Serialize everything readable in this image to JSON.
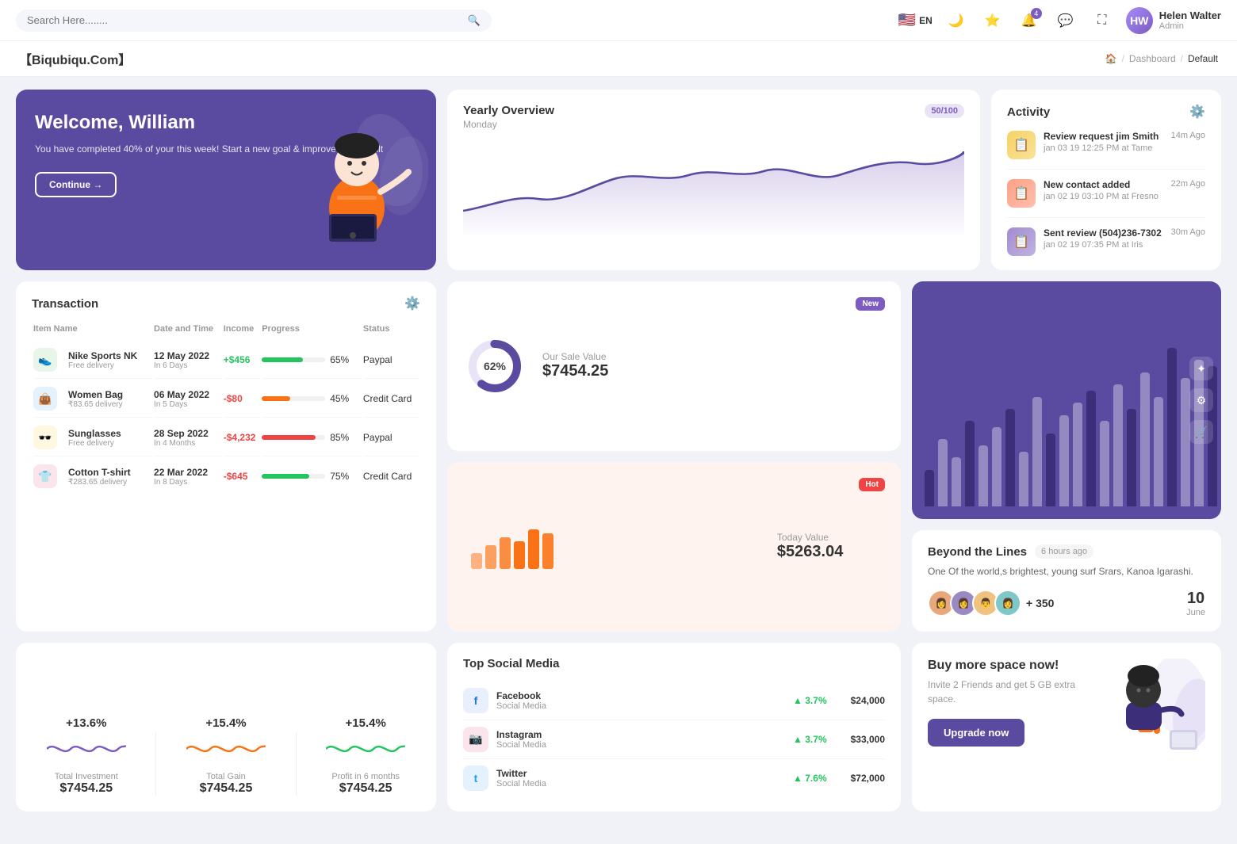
{
  "nav": {
    "search_placeholder": "Search Here........",
    "lang": "EN",
    "user": {
      "name": "Helen Walter",
      "role": "Admin",
      "initials": "HW"
    },
    "bell_count": "4"
  },
  "breadcrumb": {
    "brand": "【Biqubiqu.Com】",
    "home": "🏠",
    "dashboard": "Dashboard",
    "current": "Default"
  },
  "welcome": {
    "title": "Welcome, William",
    "body": "You have completed 40% of your this week! Start a new goal & improve your result",
    "button": "Continue →"
  },
  "overview": {
    "title": "Yearly Overview",
    "day": "Monday",
    "progress": "50/100"
  },
  "activity": {
    "title": "Activity",
    "items": [
      {
        "title": "Review request jim Smith",
        "sub": "jan 03 19 12:25 PM at Tame",
        "time": "14m Ago",
        "color": "#f6d365"
      },
      {
        "title": "New contact added",
        "sub": "jan 02 19 03:10 PM at Fresno",
        "time": "22m Ago",
        "color": "#fda085"
      },
      {
        "title": "Sent review (504)236-7302",
        "sub": "jan 02 19 07:35 PM at Iris",
        "time": "30m Ago",
        "color": "#a18cd1"
      }
    ]
  },
  "transaction": {
    "title": "Transaction",
    "columns": [
      "Item Name",
      "Date and Time",
      "Income",
      "Progress",
      "Status"
    ],
    "rows": [
      {
        "icon": "👟",
        "icon_bg": "#e8f5e9",
        "name": "Nike Sports NK",
        "sub": "Free delivery",
        "date": "12 May 2022",
        "days": "In 6 Days",
        "income": "+$456",
        "income_type": "pos",
        "progress": 65,
        "progress_color": "#22c55e",
        "status": "Paypal"
      },
      {
        "icon": "👜",
        "icon_bg": "#e3f2fd",
        "name": "Women Bag",
        "sub": "₹83.65 delivery",
        "date": "06 May 2022",
        "days": "In 5 Days",
        "income": "-$80",
        "income_type": "neg",
        "progress": 45,
        "progress_color": "#f97316",
        "status": "Credit Card"
      },
      {
        "icon": "🕶️",
        "icon_bg": "#fff8e1",
        "name": "Sunglasses",
        "sub": "Free delivery",
        "date": "28 Sep 2022",
        "days": "In 4 Months",
        "income": "-$4,232",
        "income_type": "neg",
        "progress": 85,
        "progress_color": "#ef4444",
        "status": "Paypal"
      },
      {
        "icon": "👕",
        "icon_bg": "#fce4ec",
        "name": "Cotton T-shirt",
        "sub": "₹283.65 delivery",
        "date": "22 Mar 2022",
        "days": "In 8 Days",
        "income": "-$645",
        "income_type": "neg",
        "progress": 75,
        "progress_color": "#22c55e",
        "status": "Credit Card"
      }
    ]
  },
  "sale_value": {
    "label": "Our Sale Value",
    "amount": "$7454.25",
    "pct": "62%",
    "badge": "New"
  },
  "today_value": {
    "label": "Today Value",
    "amount": "$5263.04",
    "badge": "Hot"
  },
  "beyond": {
    "title": "Beyond the Lines",
    "time_ago": "6 hours ago",
    "description": "One Of the world,s brightest, young surf Srars, Kanoa Igarashi.",
    "plus_count": "+ 350",
    "date_num": "10",
    "date_month": "June",
    "avatars": [
      "👩",
      "👩",
      "👨",
      "👩"
    ]
  },
  "stats": [
    {
      "pct": "+13.6%",
      "label": "Total Investment",
      "value": "$7454.25",
      "color": "#7c5cbf"
    },
    {
      "pct": "+15.4%",
      "label": "Total Gain",
      "value": "$7454.25",
      "color": "#f97316"
    },
    {
      "pct": "+15.4%",
      "label": "Profit in 6 months",
      "value": "$7454.25",
      "color": "#22c55e"
    }
  ],
  "social": {
    "title": "Top Social Media",
    "items": [
      {
        "name": "Facebook",
        "sub": "Social Media",
        "pct": "3.7%",
        "value": "$24,000",
        "icon": "f",
        "icon_bg": "#e8f0fe",
        "icon_color": "#1877f2"
      },
      {
        "name": "Instagram",
        "sub": "Social Media",
        "pct": "3.7%",
        "value": "$33,000",
        "icon": "📷",
        "icon_bg": "#fce4ec",
        "icon_color": "#e91e63"
      },
      {
        "name": "Twitter",
        "sub": "Social Media",
        "pct": "7.6%",
        "value": "$72,000",
        "icon": "t",
        "icon_bg": "#e3f2fd",
        "icon_color": "#1da1f2"
      }
    ]
  },
  "buy_space": {
    "title": "Buy more space now!",
    "sub": "Invite 2 Friends and get 5 GB extra space.",
    "button": "Upgrade now"
  },
  "bar_chart": {
    "bars": [
      30,
      55,
      40,
      70,
      50,
      65,
      80,
      45,
      90,
      60,
      75,
      85,
      95,
      70,
      100,
      80,
      110,
      90,
      130,
      105,
      120,
      115
    ]
  }
}
